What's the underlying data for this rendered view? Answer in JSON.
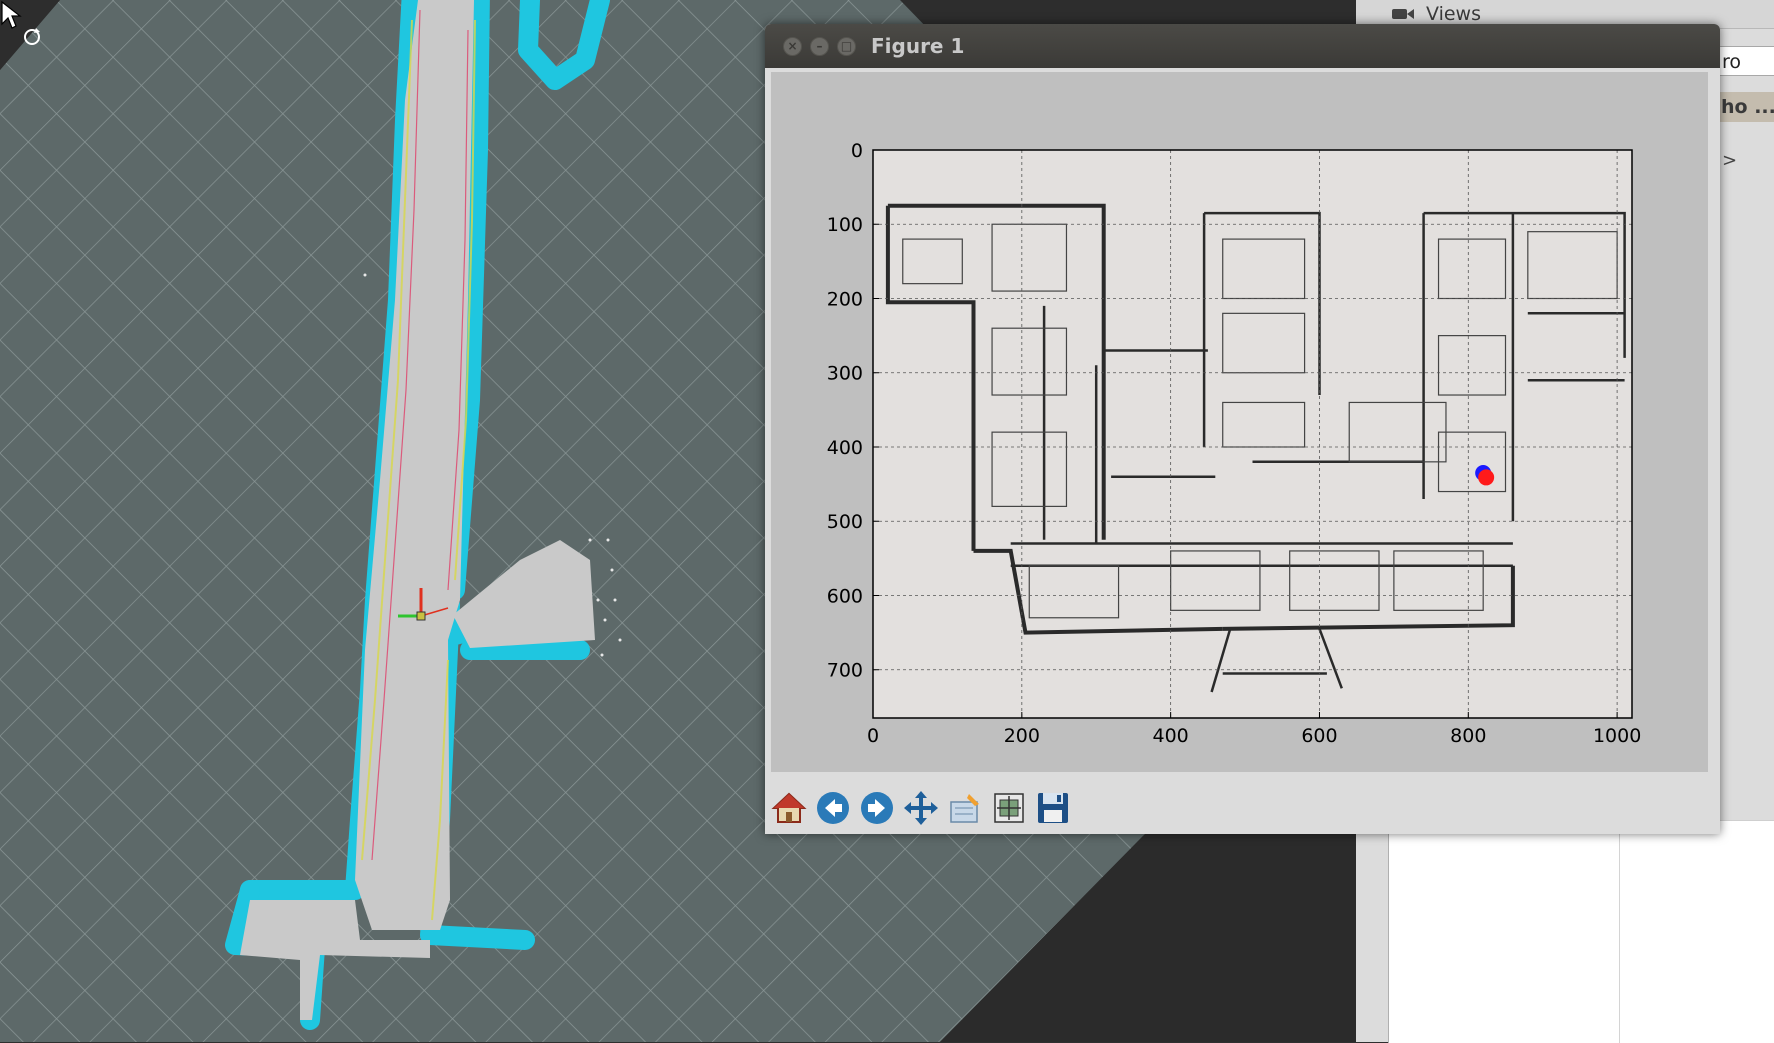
{
  "figure_window": {
    "title": "Figure 1",
    "buttons": [
      "close",
      "minimize",
      "maximize"
    ]
  },
  "side_panel": {
    "views_header": "Views",
    "ro_field": "ro",
    "ho_tab": "ho ...",
    "chevron": ">"
  },
  "toolbar": {
    "buttons": [
      {
        "name": "home-button",
        "icon": "home-icon"
      },
      {
        "name": "back-button",
        "icon": "back-arrow-icon"
      },
      {
        "name": "forward-button",
        "icon": "forward-arrow-icon"
      },
      {
        "name": "pan-button",
        "icon": "move-arrows-icon"
      },
      {
        "name": "configure-subplots-button",
        "icon": "subplots-icon"
      },
      {
        "name": "edit-axis-button",
        "icon": "edit-axis-icon"
      },
      {
        "name": "save-button",
        "icon": "floppy-disk-icon"
      }
    ]
  },
  "chart_data": {
    "type": "scatter",
    "title": "",
    "xlabel": "",
    "ylabel": "",
    "xlim": [
      0,
      1020
    ],
    "ylim": [
      765,
      0
    ],
    "x_ticks": [
      "0",
      "200",
      "400",
      "600",
      "800",
      "1000"
    ],
    "y_ticks": [
      "0",
      "100",
      "200",
      "300",
      "400",
      "500",
      "600",
      "700"
    ],
    "grid": true,
    "background": "floor plan image",
    "series": [
      {
        "color": "#1a1aff",
        "points": [
          [
            820,
            435
          ]
        ]
      },
      {
        "color": "#ff1a1a",
        "points": [
          [
            824,
            441
          ]
        ]
      }
    ]
  },
  "colors": {
    "map_free": "#c6c6c6",
    "map_wall": "#22c9e0",
    "grid_bg": "#5f6b6b"
  }
}
